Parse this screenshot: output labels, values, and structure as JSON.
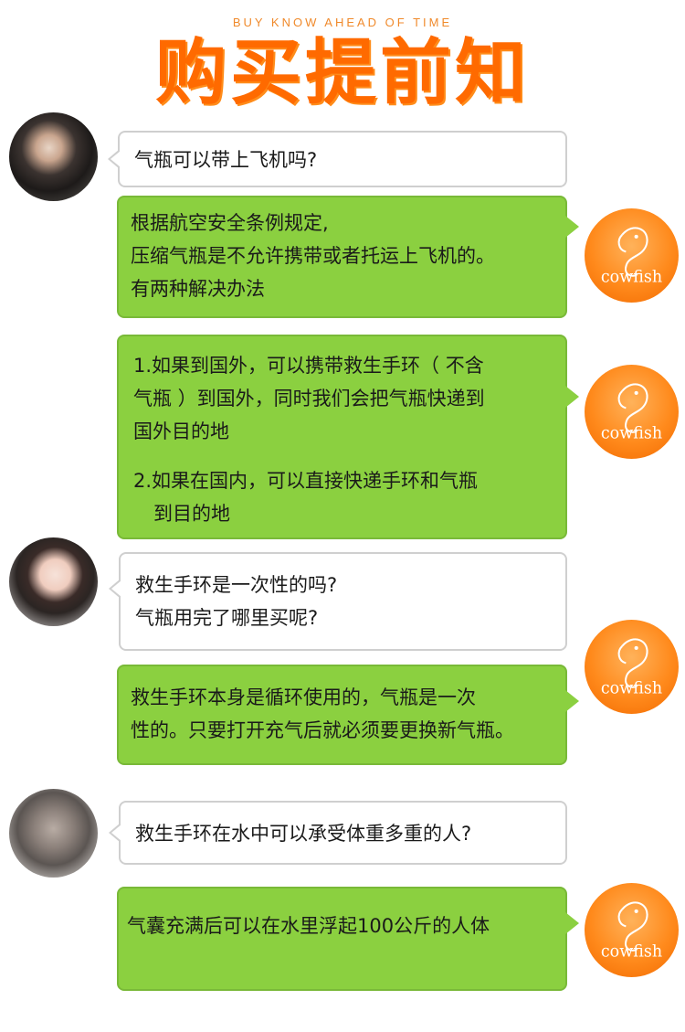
{
  "header": {
    "subtitle": "BUY KNOW AHEAD OF TIME",
    "title": "购买提前知"
  },
  "logo_text": "cowfish",
  "colors": {
    "accent": "#ff6a00",
    "answer_bubble": "#8bd040",
    "question_border": "#cfcfcf"
  },
  "conversation": [
    {
      "role": "question",
      "lines": [
        "气瓶可以带上飞机吗?"
      ]
    },
    {
      "role": "answer",
      "lines": [
        "根据航空安全条例规定,",
        "压缩气瓶是不允许携带或者托运上飞机的。",
        "有两种解决办法"
      ]
    },
    {
      "role": "answer",
      "lines": [
        "1.如果到国外，可以携带救生手环（ 不含",
        "气瓶 ）到国外，同时我们会把气瓶快递到",
        "国外目的地",
        "2.如果在国内，可以直接快递手环和气瓶",
        "到目的地"
      ]
    },
    {
      "role": "question",
      "lines": [
        "救生手环是一次性的吗?",
        "气瓶用完了哪里买呢?"
      ]
    },
    {
      "role": "answer",
      "lines": [
        "救生手环本身是循环使用的，气瓶是一次",
        "性的。只要打开充气后就必须要更换新气瓶。"
      ]
    },
    {
      "role": "question",
      "lines": [
        "救生手环在水中可以承受体重多重的人?"
      ]
    },
    {
      "role": "answer",
      "lines": [
        "气囊充满后可以在水里浮起100公斤的人体"
      ]
    }
  ]
}
